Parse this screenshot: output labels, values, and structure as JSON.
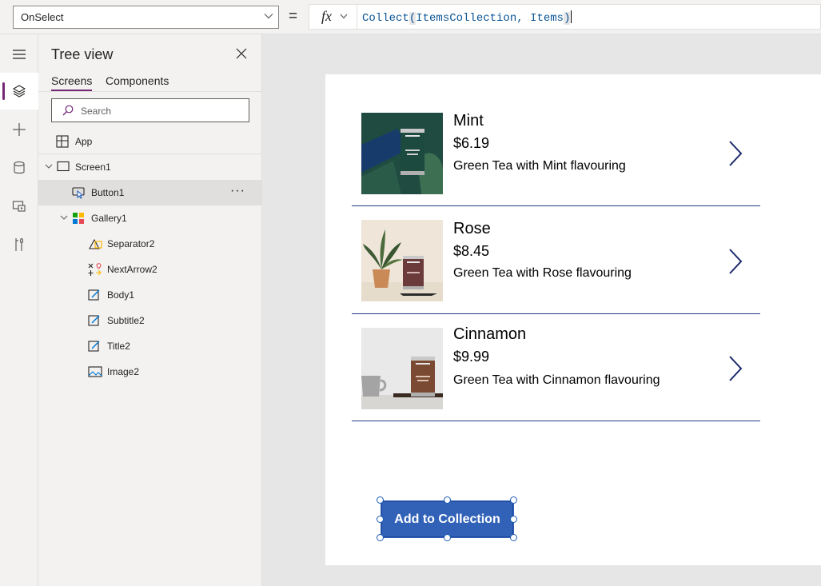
{
  "formula_bar": {
    "property": "OnSelect",
    "equals": "=",
    "fx_label": "fx",
    "formula": {
      "fn": "Collect",
      "open": "(",
      "arg1": "ItemsCollection",
      "comma": ", ",
      "arg2": "Items",
      "close": ")"
    }
  },
  "rail": {
    "items": [
      {
        "icon": "hamburger-menu-icon"
      },
      {
        "icon": "layers-icon",
        "active": true
      },
      {
        "icon": "plus-icon"
      },
      {
        "icon": "database-icon"
      },
      {
        "icon": "media-icon"
      },
      {
        "icon": "tools-icon"
      }
    ]
  },
  "tree_view": {
    "title": "Tree view",
    "tabs": [
      "Screens",
      "Components"
    ],
    "active_tab": "Screens",
    "search_placeholder": "Search",
    "app_label": "App",
    "nodes": [
      {
        "label": "Screen1",
        "icon": "screen-icon"
      },
      {
        "label": "Button1",
        "icon": "button-icon",
        "selected": true
      },
      {
        "label": "Gallery1",
        "icon": "gallery-icon"
      },
      {
        "label": "Separator2",
        "icon": "shapes-icon"
      },
      {
        "label": "NextArrow2",
        "icon": "icons-icon"
      },
      {
        "label": "Body1",
        "icon": "label-icon"
      },
      {
        "label": "Subtitle2",
        "icon": "label-icon"
      },
      {
        "label": "Title2",
        "icon": "label-icon"
      },
      {
        "label": "Image2",
        "icon": "image-icon"
      }
    ],
    "more_label": "···"
  },
  "gallery": {
    "items": [
      {
        "title": "Mint",
        "price": "$6.19",
        "body": "Green Tea with Mint flavouring"
      },
      {
        "title": "Rose",
        "price": "$8.45",
        "body": "Green Tea with Rose flavouring"
      },
      {
        "title": "Cinnamon",
        "price": "$9.99",
        "body": "Green Tea with Cinnamon flavouring"
      }
    ]
  },
  "button": {
    "label": "Add to Collection"
  },
  "colors": {
    "accent_purple": "#742774",
    "button_blue": "#3162b8",
    "separator_navy": "#203a86",
    "arrow_navy": "#1b2a6b"
  }
}
